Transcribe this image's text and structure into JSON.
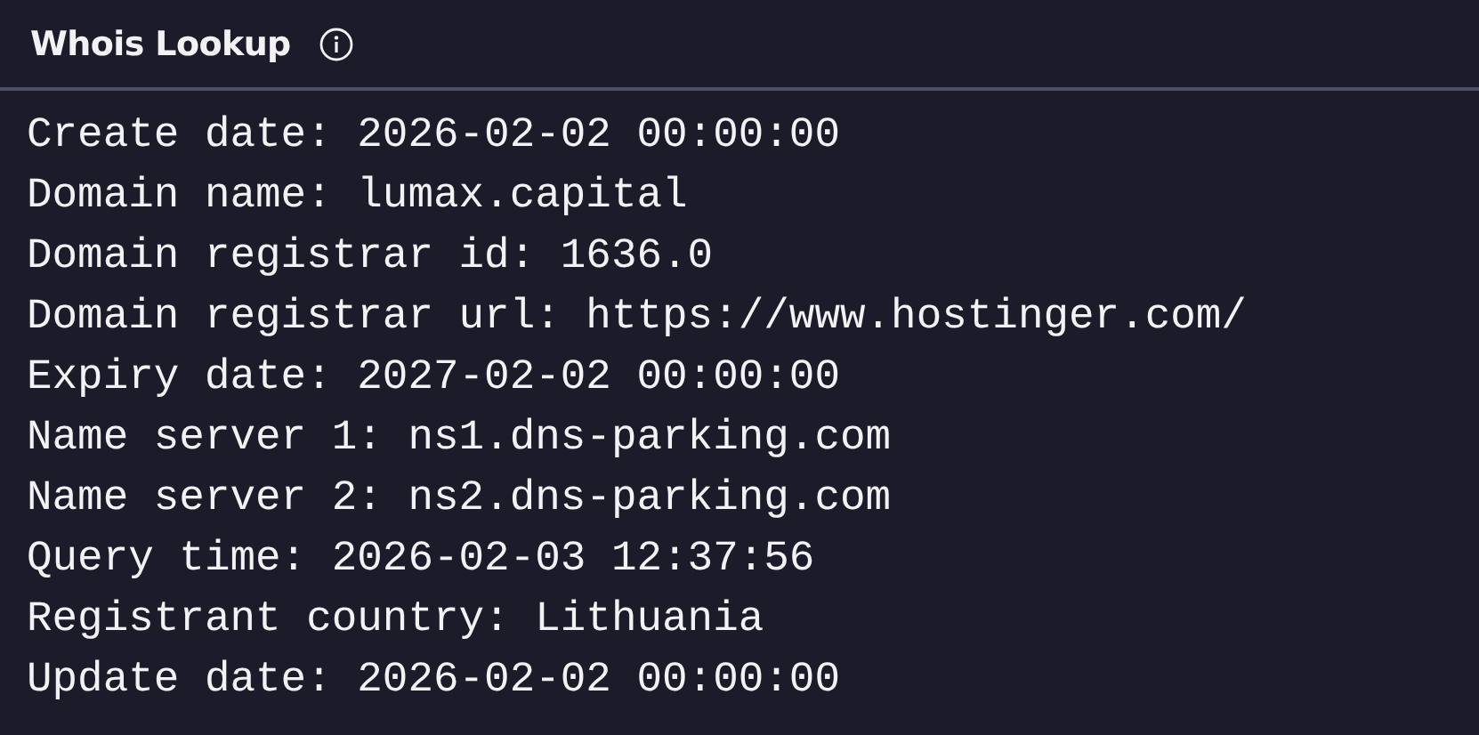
{
  "panel": {
    "title": "Whois Lookup"
  },
  "lines": [
    "Create date: 2026-02-02 00:00:00",
    "Domain name: lumax.capital",
    "Domain registrar id: 1636.0",
    "Domain registrar url: https://www.hostinger.com/",
    "Expiry date: 2027-02-02 00:00:00",
    "Name server 1: ns1.dns-parking.com",
    "Name server 2: ns2.dns-parking.com",
    "Query time: 2026-02-03 12:37:56",
    "Registrant country: Lithuania",
    "Update date: 2026-02-02 00:00:00"
  ]
}
